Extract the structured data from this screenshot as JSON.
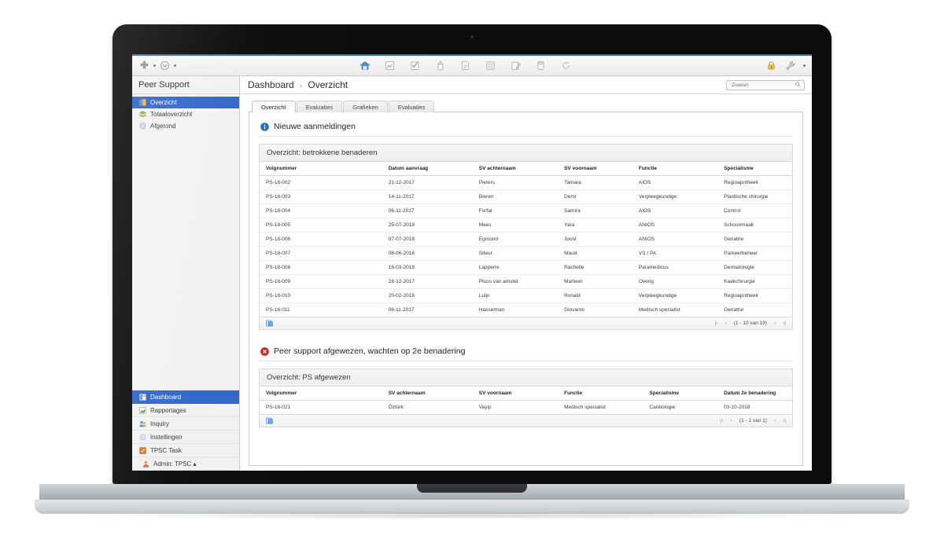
{
  "device": {
    "label": "MacBook Pro"
  },
  "toolbar": {
    "left_icons": [
      "plus-icon",
      "dropdown-caret-icon"
    ],
    "center_icons": [
      "home-icon",
      "report-icon",
      "checklist-icon",
      "hand-pointer-icon",
      "document-icon",
      "grid-icon",
      "edit-note-icon",
      "database-icon",
      "refresh-icon"
    ],
    "right_icons": [
      "lock-warning-icon",
      "wrench-icon"
    ]
  },
  "sidebar": {
    "title": "Peer Support",
    "items": [
      {
        "label": "Overzicht",
        "icon": "overview-icon",
        "active": true
      },
      {
        "label": "Totaaloverzicht",
        "icon": "stack-icon",
        "active": false
      },
      {
        "label": "Afgerond",
        "icon": "shield-icon",
        "active": false
      }
    ],
    "bottom_items": [
      {
        "label": "Dashboard",
        "icon": "dashboard-icon",
        "active": true
      },
      {
        "label": "Rapportages",
        "icon": "chart-icon",
        "active": false
      },
      {
        "label": "Inquiry",
        "icon": "people-icon",
        "active": false
      },
      {
        "label": "Instellingen",
        "icon": "gear-icon",
        "active": false
      },
      {
        "label": "TPSC Task",
        "icon": "task-icon",
        "active": false
      },
      {
        "label": "Admin: TPSC ▴",
        "icon": "user-icon",
        "active": false
      }
    ]
  },
  "breadcrumb": {
    "root": "Dashboard",
    "separator": "›",
    "current": "Overzicht"
  },
  "search": {
    "placeholder": "Zoeken",
    "value": "",
    "icon": "search-icon"
  },
  "tabs": [
    {
      "label": "Overzicht",
      "active": true
    },
    {
      "label": "Evaluaties",
      "active": false
    },
    {
      "label": "Grafieken",
      "active": false
    },
    {
      "label": "Evaluaties",
      "active": false
    }
  ],
  "sections": [
    {
      "heading": "Nieuwe aanmeldingen",
      "heading_icon": "info-icon",
      "heading_color": "#1a73c8",
      "card_title": "Overzicht: betrokkene benaderen",
      "columns": [
        "Volgnummer",
        "Datum aanvraag",
        "SV achternaam",
        "SV voornaam",
        "Functie",
        "Specialisme"
      ],
      "col_widths": [
        "23%",
        "17%",
        "16%",
        "14%",
        "16%",
        "14%"
      ],
      "rows": [
        [
          "PS-18-002",
          "21-12-2017",
          "Pieters",
          "Tamara",
          "AIOS",
          "Regioapotheek"
        ],
        [
          "PS-18-003",
          "14-11-2017",
          "Bieren",
          "Demi",
          "Verpleegkundige",
          "Plastische chirurgie"
        ],
        [
          "PS-18-004",
          "06-11-2017",
          "Forfar",
          "Samira",
          "AIOS",
          "Control"
        ],
        [
          "PS-18-005",
          "25-07-2018",
          "Mees",
          "Yara",
          "ANIOS",
          "Schoonmaak"
        ],
        [
          "PS-18-006",
          "07-07-2018",
          "Egmond",
          "Joost",
          "ANIOS",
          "Geriatrie"
        ],
        [
          "PS-18-007",
          "08-06-2018",
          "Siteur",
          "Maud",
          "VS / PA",
          "Parkeerbeheer"
        ],
        [
          "PS-18-008",
          "16-03-2018",
          "Lapperre",
          "Rachelle",
          "Paramedicus",
          "Dermatologie"
        ],
        [
          "PS-18-009",
          "28-12-2017",
          "Ploos van amstel",
          "Marleen",
          "Overig",
          "Kaakchirurgie"
        ],
        [
          "PS-18-010",
          "20-02-2018",
          "Luijn",
          "Ronald",
          "Verpleegkundige",
          "Regioapotheek"
        ],
        [
          "PS-18-011",
          "06-11-2017",
          "Hasselman",
          "Giovanni",
          "Medisch specialist",
          "Geriatrie"
        ]
      ],
      "export_icon": "export-excel-icon",
      "pagination": {
        "first": "|‹",
        "prev": "‹",
        "text": "(1 - 10 van 19)",
        "next": "›",
        "last": "›|"
      }
    },
    {
      "heading": "Peer support afgewezen, wachten op 2e benadering",
      "heading_icon": "error-icon",
      "heading_color": "#d0211c",
      "card_title": "Overzicht: PS afgewezen",
      "columns": [
        "Volgnummer",
        "SV achternaam",
        "SV voornaam",
        "Functie",
        "Specialisme",
        "Datum 2e benadering"
      ],
      "col_widths": [
        "23%",
        "17%",
        "16%",
        "16%",
        "14%",
        "14%"
      ],
      "rows": [
        [
          "PS-18-021",
          "Öztürk",
          "Vayip",
          "Medisch specialist",
          "Cardiologie",
          "03-10-2018"
        ]
      ],
      "export_icon": "export-excel-icon",
      "pagination": {
        "first": "|‹",
        "prev": "‹",
        "text": "(1 - 1 van 1)",
        "next": "›",
        "last": "›|"
      }
    }
  ],
  "colors": {
    "accent": "#2f66c9",
    "info": "#1a73c8",
    "error": "#d0211c",
    "titlebar": "#2f6fc4"
  }
}
